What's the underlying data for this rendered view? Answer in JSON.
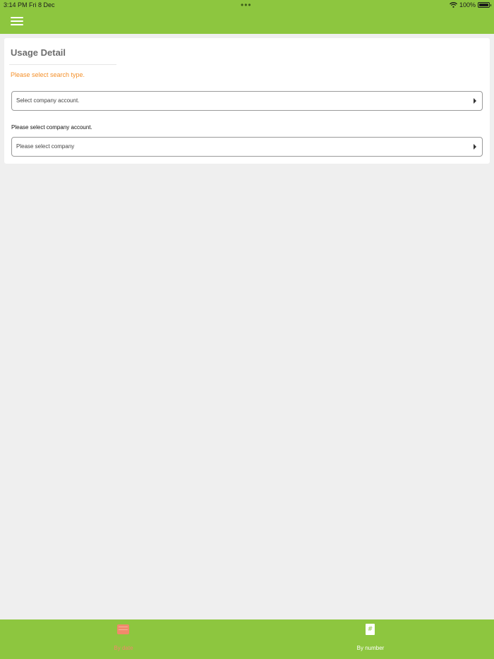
{
  "status_bar": {
    "time_date": "3:14 PM   Fri 8 Dec",
    "dots": "•••",
    "battery_percent": "100%"
  },
  "header": {
    "menu_icon": "hamburger-menu-icon"
  },
  "main": {
    "title": "Usage Detail",
    "search_type_prompt": "Please select search type.",
    "account_select": {
      "value": "Select company account."
    },
    "company_label": "Please select company account.",
    "company_select": {
      "value": "Please select company"
    }
  },
  "tabbar": {
    "tabs": [
      {
        "label": "By date",
        "icon": "calendar-icon",
        "active": true
      },
      {
        "label": "By number",
        "icon": "hash-icon",
        "active": false
      }
    ]
  },
  "colors": {
    "brand_green": "#8dc63f",
    "accent_orange": "#f4902a",
    "active_tab": "#f08a6b",
    "background": "#efefef"
  }
}
